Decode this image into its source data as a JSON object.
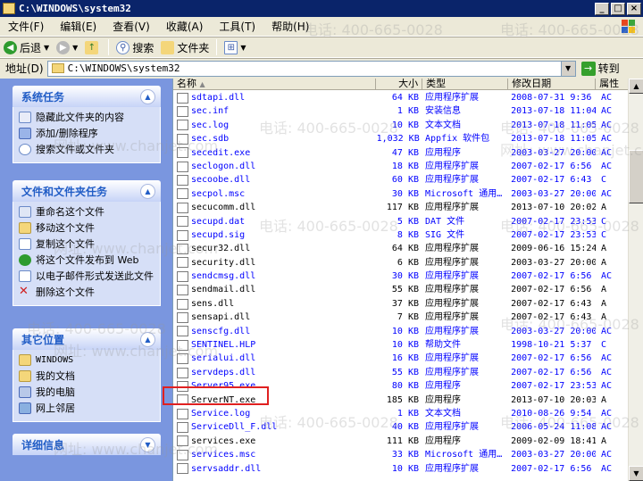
{
  "window": {
    "title": "C:\\WINDOWS\\system32"
  },
  "menu": [
    "文件(F)",
    "编辑(E)",
    "查看(V)",
    "收藏(A)",
    "工具(T)",
    "帮助(H)"
  ],
  "toolbar": {
    "back": "后退",
    "search": "搜索",
    "folders": "文件夹"
  },
  "address": {
    "label": "地址(D)",
    "path": "C:\\WINDOWS\\system32",
    "go": "转到"
  },
  "left": {
    "system_tasks": {
      "title": "系统任务",
      "items": [
        "隐藏此文件夹的内容",
        "添加/删除程序",
        "搜索文件或文件夹"
      ]
    },
    "file_tasks": {
      "title": "文件和文件夹任务",
      "items": [
        "重命名这个文件",
        "移动这个文件",
        "复制这个文件",
        "将这个文件发布到 Web",
        "以电子邮件形式发送此文件",
        "删除这个文件"
      ]
    },
    "other_places": {
      "title": "其它位置",
      "items": [
        "WINDOWS",
        "我的文档",
        "我的电脑",
        "网上邻居"
      ]
    },
    "details": {
      "title": "详细信息"
    }
  },
  "columns": {
    "name": "名称",
    "size": "大小",
    "type": "类型",
    "modified": "修改日期",
    "attr": "属性"
  },
  "files": [
    {
      "name": "sdtapi.dll",
      "size": "64 KB",
      "type": "应用程序扩展",
      "date": "2008-07-31 9:36",
      "attr": "AC",
      "blue": true
    },
    {
      "name": "sec.inf",
      "size": "1 KB",
      "type": "安装信息",
      "date": "2013-07-18 11:04",
      "attr": "AC",
      "blue": true
    },
    {
      "name": "sec.log",
      "size": "10 KB",
      "type": "文本文档",
      "date": "2013-07-18 11:05",
      "attr": "AC",
      "blue": true
    },
    {
      "name": "sec.sdb",
      "size": "1,032 KB",
      "type": "Appfix 软件包",
      "date": "2013-07-18 11:05",
      "attr": "AC",
      "blue": true
    },
    {
      "name": "secedit.exe",
      "size": "47 KB",
      "type": "应用程序",
      "date": "2003-03-27 20:00",
      "attr": "AC",
      "blue": true
    },
    {
      "name": "seclogon.dll",
      "size": "18 KB",
      "type": "应用程序扩展",
      "date": "2007-02-17 6:56",
      "attr": "AC",
      "blue": true
    },
    {
      "name": "secoobe.dll",
      "size": "60 KB",
      "type": "应用程序扩展",
      "date": "2007-02-17 6:43",
      "attr": "C",
      "blue": true
    },
    {
      "name": "secpol.msc",
      "size": "30 KB",
      "type": "Microsoft 通用…",
      "date": "2003-03-27 20:00",
      "attr": "AC",
      "blue": true
    },
    {
      "name": "secucomm.dll",
      "size": "117 KB",
      "type": "应用程序扩展",
      "date": "2013-07-10 20:02",
      "attr": "A",
      "blue": false
    },
    {
      "name": "secupd.dat",
      "size": "5 KB",
      "type": "DAT 文件",
      "date": "2007-02-17 23:53",
      "attr": "C",
      "blue": true
    },
    {
      "name": "secupd.sig",
      "size": "8 KB",
      "type": "SIG 文件",
      "date": "2007-02-17 23:53",
      "attr": "C",
      "blue": true
    },
    {
      "name": "secur32.dll",
      "size": "64 KB",
      "type": "应用程序扩展",
      "date": "2009-06-16 15:24",
      "attr": "A",
      "blue": false
    },
    {
      "name": "security.dll",
      "size": "6 KB",
      "type": "应用程序扩展",
      "date": "2003-03-27 20:00",
      "attr": "A",
      "blue": false
    },
    {
      "name": "sendcmsg.dll",
      "size": "30 KB",
      "type": "应用程序扩展",
      "date": "2007-02-17 6:56",
      "attr": "AC",
      "blue": true
    },
    {
      "name": "sendmail.dll",
      "size": "55 KB",
      "type": "应用程序扩展",
      "date": "2007-02-17 6:56",
      "attr": "A",
      "blue": false
    },
    {
      "name": "sens.dll",
      "size": "37 KB",
      "type": "应用程序扩展",
      "date": "2007-02-17 6:43",
      "attr": "A",
      "blue": false
    },
    {
      "name": "sensapi.dll",
      "size": "7 KB",
      "type": "应用程序扩展",
      "date": "2007-02-17 6:43",
      "attr": "A",
      "blue": false
    },
    {
      "name": "senscfg.dll",
      "size": "10 KB",
      "type": "应用程序扩展",
      "date": "2003-03-27 20:00",
      "attr": "AC",
      "blue": true
    },
    {
      "name": "SENTINEL.HLP",
      "size": "10 KB",
      "type": "帮助文件",
      "date": "1998-10-21 5:37",
      "attr": "C",
      "blue": true
    },
    {
      "name": "serialui.dll",
      "size": "16 KB",
      "type": "应用程序扩展",
      "date": "2007-02-17 6:56",
      "attr": "AC",
      "blue": true
    },
    {
      "name": "servdeps.dll",
      "size": "55 KB",
      "type": "应用程序扩展",
      "date": "2007-02-17 6:56",
      "attr": "AC",
      "blue": true
    },
    {
      "name": "Server95.exe",
      "size": "80 KB",
      "type": "应用程序",
      "date": "2007-02-17 23:53",
      "attr": "AC",
      "blue": true
    },
    {
      "name": "ServerNT.exe",
      "size": "185 KB",
      "type": "应用程序",
      "date": "2013-07-10 20:03",
      "attr": "A",
      "blue": false
    },
    {
      "name": "Service.log",
      "size": "1 KB",
      "type": "文本文档",
      "date": "2010-08-26 9:54",
      "attr": "AC",
      "blue": true
    },
    {
      "name": "ServiceDll_F.dll",
      "size": "40 KB",
      "type": "应用程序扩展",
      "date": "2006-05-24 11:08",
      "attr": "AC",
      "blue": true
    },
    {
      "name": "services.exe",
      "size": "111 KB",
      "type": "应用程序",
      "date": "2009-02-09 18:41",
      "attr": "A",
      "blue": false
    },
    {
      "name": "services.msc",
      "size": "33 KB",
      "type": "Microsoft 通用…",
      "date": "2003-03-27 20:00",
      "attr": "AC",
      "blue": true
    },
    {
      "name": "servsaddr.dll",
      "size": "10 KB",
      "type": "应用程序扩展",
      "date": "2007-02-17 6:56",
      "attr": "AC",
      "blue": true
    }
  ],
  "watermark": {
    "phone": "电话: 400-665-0028",
    "site": "网址: www.chanjet.com"
  },
  "colors": {
    "title_bg": "#0a246a",
    "task_bg": "#7a96df",
    "task_head": "#215dc6",
    "highlight": "#e02020",
    "link": "#0000ff"
  }
}
